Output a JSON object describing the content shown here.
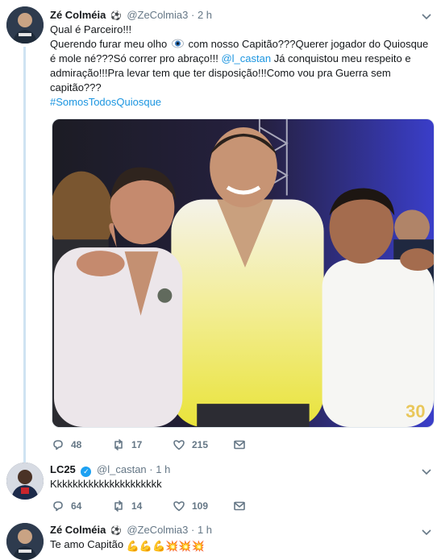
{
  "tweets": [
    {
      "name": "Zé Colméia",
      "badge": "⚽",
      "handle": "@ZeColmia3",
      "time": "2 h",
      "lines": {
        "l1": "Qual é Parceiro!!!",
        "l2a": "Querendo furar meu olho",
        "l2b": "com nosso Capitão???Querer jogador do Quiosque",
        "l3": "é mole né???Só correr pro abraço!!!",
        "mention": "@l_castan",
        "l3b": "Já conquistou meu respeito e",
        "l4": "admiração!!!Pra levar tem que ter disposição!!!Como vou pra Guerra sem",
        "l5": "capitão???",
        "hashtag": "#SomosTodosQuiosque"
      },
      "replies": "48",
      "retweets": "17",
      "likes": "215"
    },
    {
      "name": "LC25",
      "handle": "@l_castan",
      "time": "1 h",
      "text": "Kkkkkkkkkkkkkkkkkkkkk",
      "replies": "64",
      "retweets": "14",
      "likes": "109"
    },
    {
      "name": "Zé Colméia",
      "badge": "⚽",
      "handle": "@ZeColmia3",
      "time": "1 h",
      "text": "Te amo Capitão",
      "emojis": "💪💪💪💥💥💥"
    }
  ],
  "separator": "·",
  "caret_icon": "chevron-down-icon",
  "colors": {
    "link": "#1b95e0",
    "muted": "#657786",
    "thread": "#cfe3f2",
    "verified": "#1da1f2"
  }
}
